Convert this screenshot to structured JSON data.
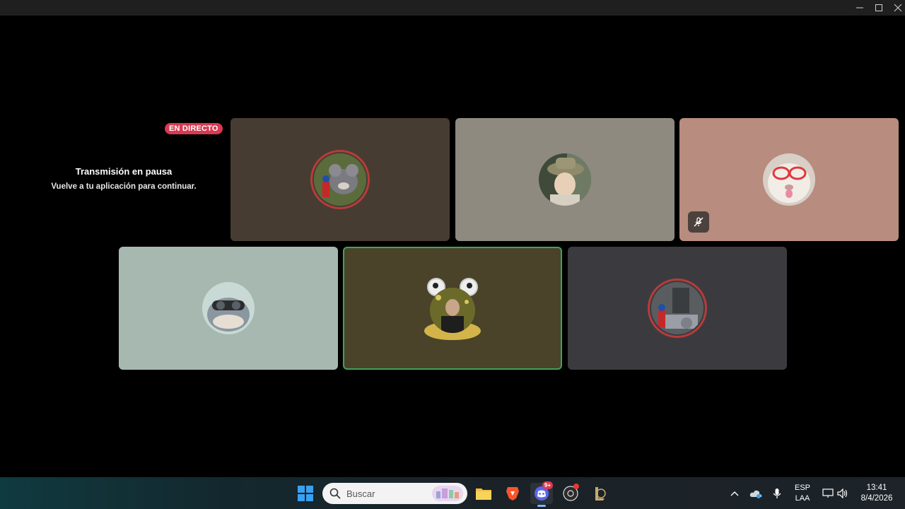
{
  "window": {
    "controls": [
      "minimize",
      "maximize",
      "close"
    ]
  },
  "stream": {
    "live_badge": "EN DIRECTO",
    "paused_title": "Transmisión en pausa",
    "paused_subtitle": "Vuelve a tu aplicación para continuar."
  },
  "participants": [
    {
      "tile_color": "#463c32",
      "avatar": "cartoon-mouse-avatar",
      "decoration": "ring",
      "speaking": false,
      "muted": false
    },
    {
      "tile_color": "#8e8a80",
      "avatar": "person-hat-avatar",
      "decoration": "none",
      "speaking": false,
      "muted": false
    },
    {
      "tile_color": "#b88c7e",
      "avatar": "cat-glasses-avatar",
      "decoration": "none",
      "speaking": false,
      "muted": true
    },
    {
      "tile_color": "#a7b8b1",
      "avatar": "shark-goggles-avatar",
      "decoration": "none",
      "speaking": false,
      "muted": false
    },
    {
      "tile_color": "#4a4329",
      "avatar": "frog-frame-avatar",
      "decoration": "frog",
      "speaking": true,
      "muted": false
    },
    {
      "tile_color": "#3b3b3f",
      "avatar": "photo-avatar",
      "decoration": "ring",
      "speaking": false,
      "muted": false
    }
  ],
  "taskbar": {
    "search_placeholder": "Buscar",
    "discord_badge": "9+",
    "language": "ESP",
    "layout": "LAA",
    "time": "13:41",
    "date": "8/4/2026"
  },
  "colors": {
    "live": "#d83a52",
    "speaking_border": "#3ba55d"
  }
}
